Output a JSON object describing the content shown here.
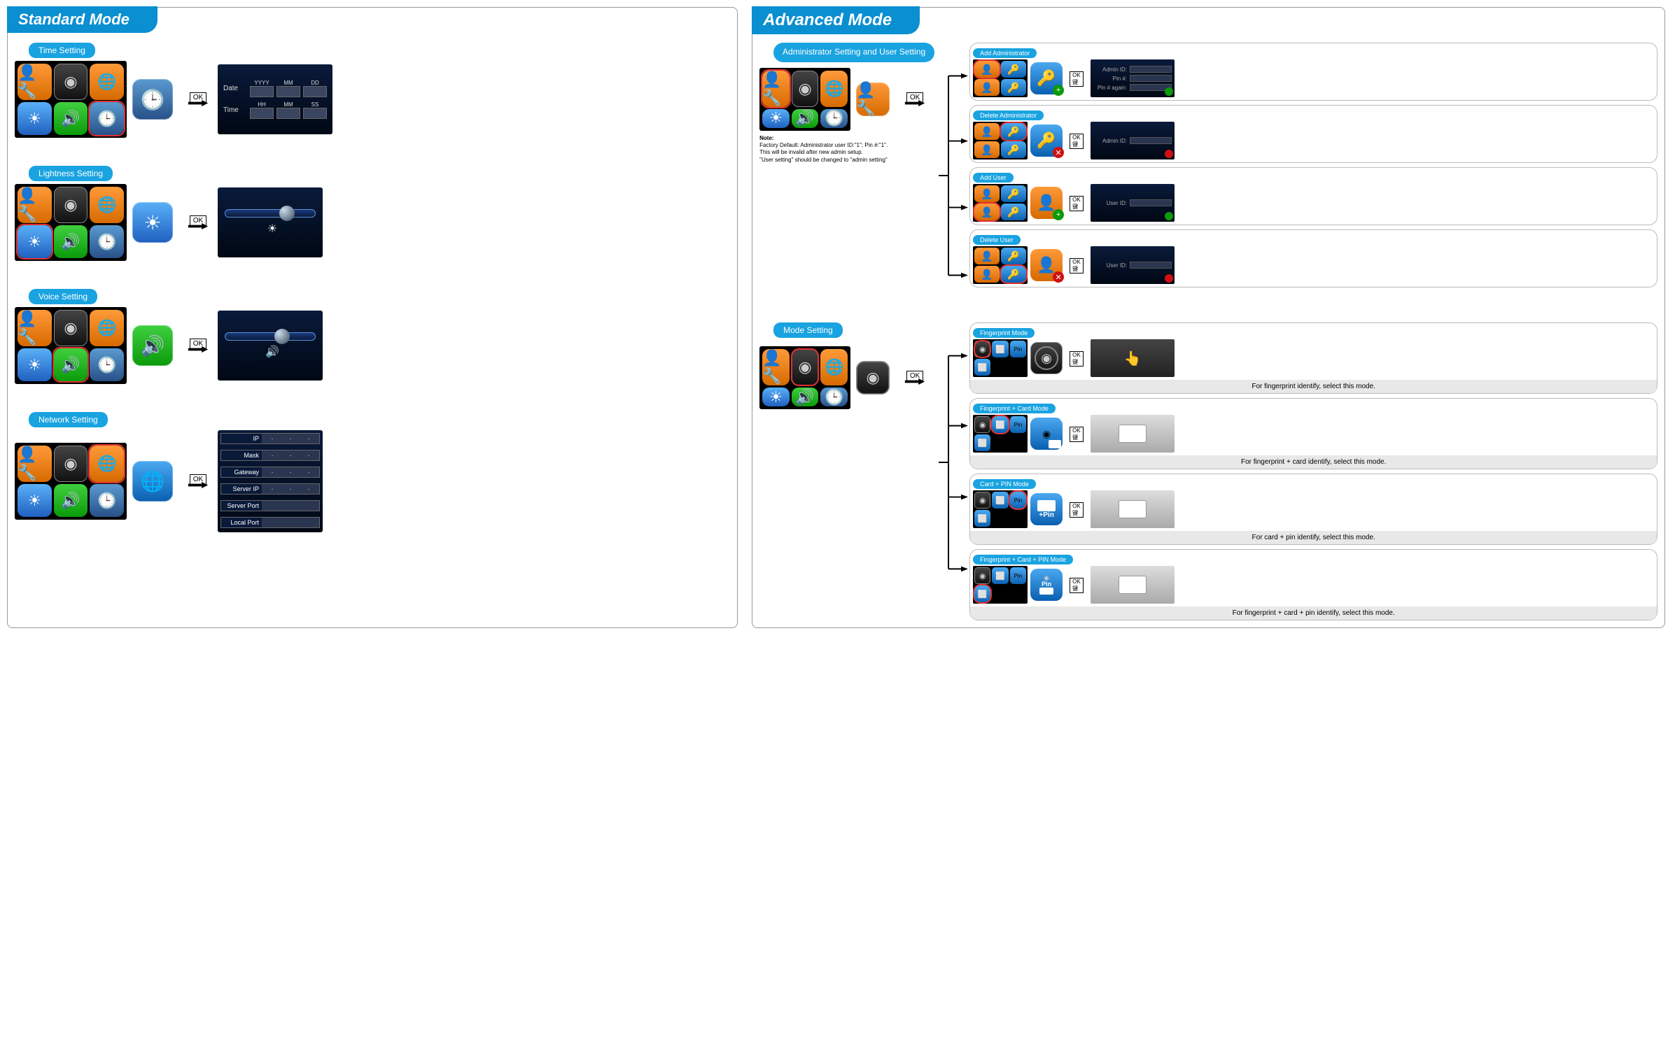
{
  "left": {
    "title": "Standard Mode",
    "sections": {
      "time": {
        "pill": "Time Setting",
        "ok": "OK",
        "date_label": "Date",
        "time_label": "Time",
        "cols_date": [
          "YYYY",
          "MM",
          "DD"
        ],
        "cols_time": [
          "HH",
          "MM",
          "SS"
        ]
      },
      "light": {
        "pill": "Lightness Setting",
        "ok": "OK"
      },
      "voice": {
        "pill": "Voice Setting",
        "ok": "OK"
      },
      "net": {
        "pill": "Network Setting",
        "ok": "OK",
        "rows": [
          "IP",
          "Mask",
          "Gateway",
          "Server IP",
          "Server Port",
          "Local Port"
        ]
      }
    }
  },
  "right": {
    "title": "Advanced Mode",
    "admin": {
      "pill": "Administrator Setting and User  Setting",
      "ok": "OK",
      "note_title": "Note:",
      "note1": "Factory Default: Administrator user ID:\"1\"; Pin #:\"1\".",
      "note2": "This will be invalid after new admin setup.",
      "note3": "\"User setting\" should be changed to \"admin setting\"",
      "items": {
        "add_admin": {
          "pill": "Add Administrator",
          "ok": "OK 键",
          "f1": "Admin ID:",
          "f2": "Pin #:",
          "f3": "Pin # again:"
        },
        "del_admin": {
          "pill": "Delete Administrator",
          "ok": "OK 键",
          "f1": "Admin ID:"
        },
        "add_user": {
          "pill": "Add User",
          "ok": "OK 键",
          "f1": "User ID:"
        },
        "del_user": {
          "pill": "Delete User",
          "ok": "OK 键",
          "f1": "User ID:"
        }
      }
    },
    "mode": {
      "pill": "Mode Setting",
      "ok": "OK",
      "items": {
        "fp": {
          "pill": "Fingerprint Mode",
          "ok": "OK 键",
          "note": "For fingerprint  identify, select this mode."
        },
        "fpc": {
          "pill": "Fingerprint + Card Mode",
          "ok": "OK 键",
          "note": "For fingerprint + card identify, select this mode."
        },
        "cp": {
          "pill": "Card + PIN Mode",
          "ok": "OK 键",
          "note": "For card + pin identify, select this mode."
        },
        "fpcp": {
          "pill": "Fingerprint + Card + PIN Mode",
          "ok": "OK 键",
          "note": "For fingerprint + card + pin identify, select this mode."
        }
      }
    }
  },
  "glyph": {
    "user": "👤",
    "wrench": "🔧",
    "fp": "◉",
    "globe": "🌐",
    "sun": "☀",
    "speaker": "🔊",
    "clock": "🕒",
    "key": "🔑",
    "card": "⬜",
    "plus": "+",
    "pin": "Pin"
  }
}
